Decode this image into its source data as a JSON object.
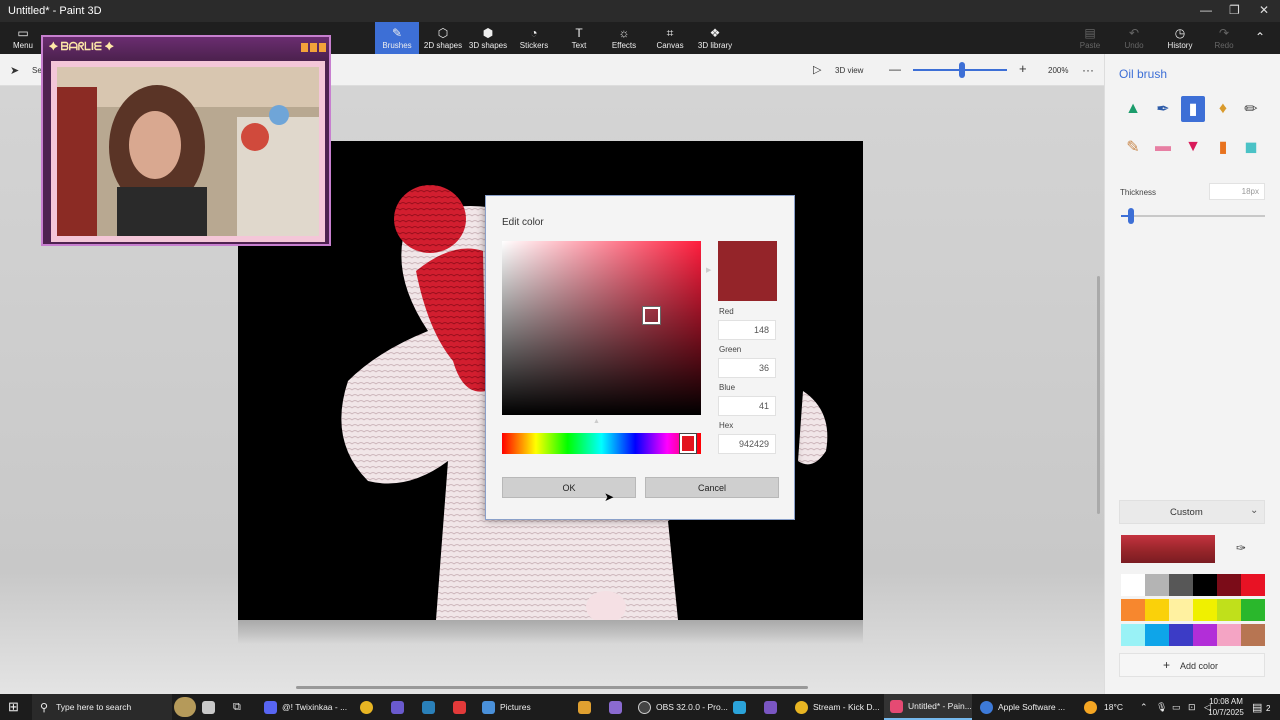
{
  "window": {
    "title": "Untitled* - Paint 3D"
  },
  "ribbon": {
    "menu": "Menu",
    "tabs": [
      "Brushes",
      "2D shapes",
      "3D shapes",
      "Stickers",
      "Text",
      "Effects",
      "Canvas",
      "3D library"
    ],
    "right": [
      "Paste",
      "Undo",
      "History",
      "Redo"
    ]
  },
  "toolbar": {
    "select": "Se",
    "view3d": "3D view",
    "zoom": "200%",
    "more": "···"
  },
  "panel": {
    "title": "Oil brush",
    "thickness_label": "Thickness",
    "thickness_value": "18px",
    "thickness_level": 0.07,
    "palette_mode": "Custom",
    "current_color": "#942429",
    "add_color": "Add color",
    "swatches": [
      "#ffffff",
      "#b4b4b4",
      "#575757",
      "#000000",
      "#7b0c18",
      "#e81224",
      "#f7872e",
      "#fad10a",
      "#fff1a0",
      "#f0f000",
      "#c0e01b",
      "#2ab72c",
      "#99f2f6",
      "#0ea5e9",
      "#3c3cc6",
      "#b22ed8",
      "#f4a4c4",
      "#b77552"
    ]
  },
  "dialog": {
    "title": "Edit color",
    "red_label": "Red",
    "red": "148",
    "green_label": "Green",
    "green": "36",
    "blue_label": "Blue",
    "blue": "41",
    "hex_label": "Hex",
    "hex": "942429",
    "ok": "OK",
    "cancel": "Cancel",
    "preview_color": "#942429"
  },
  "webcam": {
    "title": "✦ ᗷᗩᖇᒪIᗴ ✦"
  },
  "taskbar": {
    "search": "Type here to search",
    "items": [
      "@! Twixinkaa - ...",
      "Pictures",
      "OBS 32.0.0 - Pro...",
      "Stream - Kick D...",
      "Untitled* - Pain...",
      "Apple Software ..."
    ],
    "weather": "18°C",
    "time": "10:08 AM",
    "date": "10/7/2025",
    "notifications": "2"
  }
}
